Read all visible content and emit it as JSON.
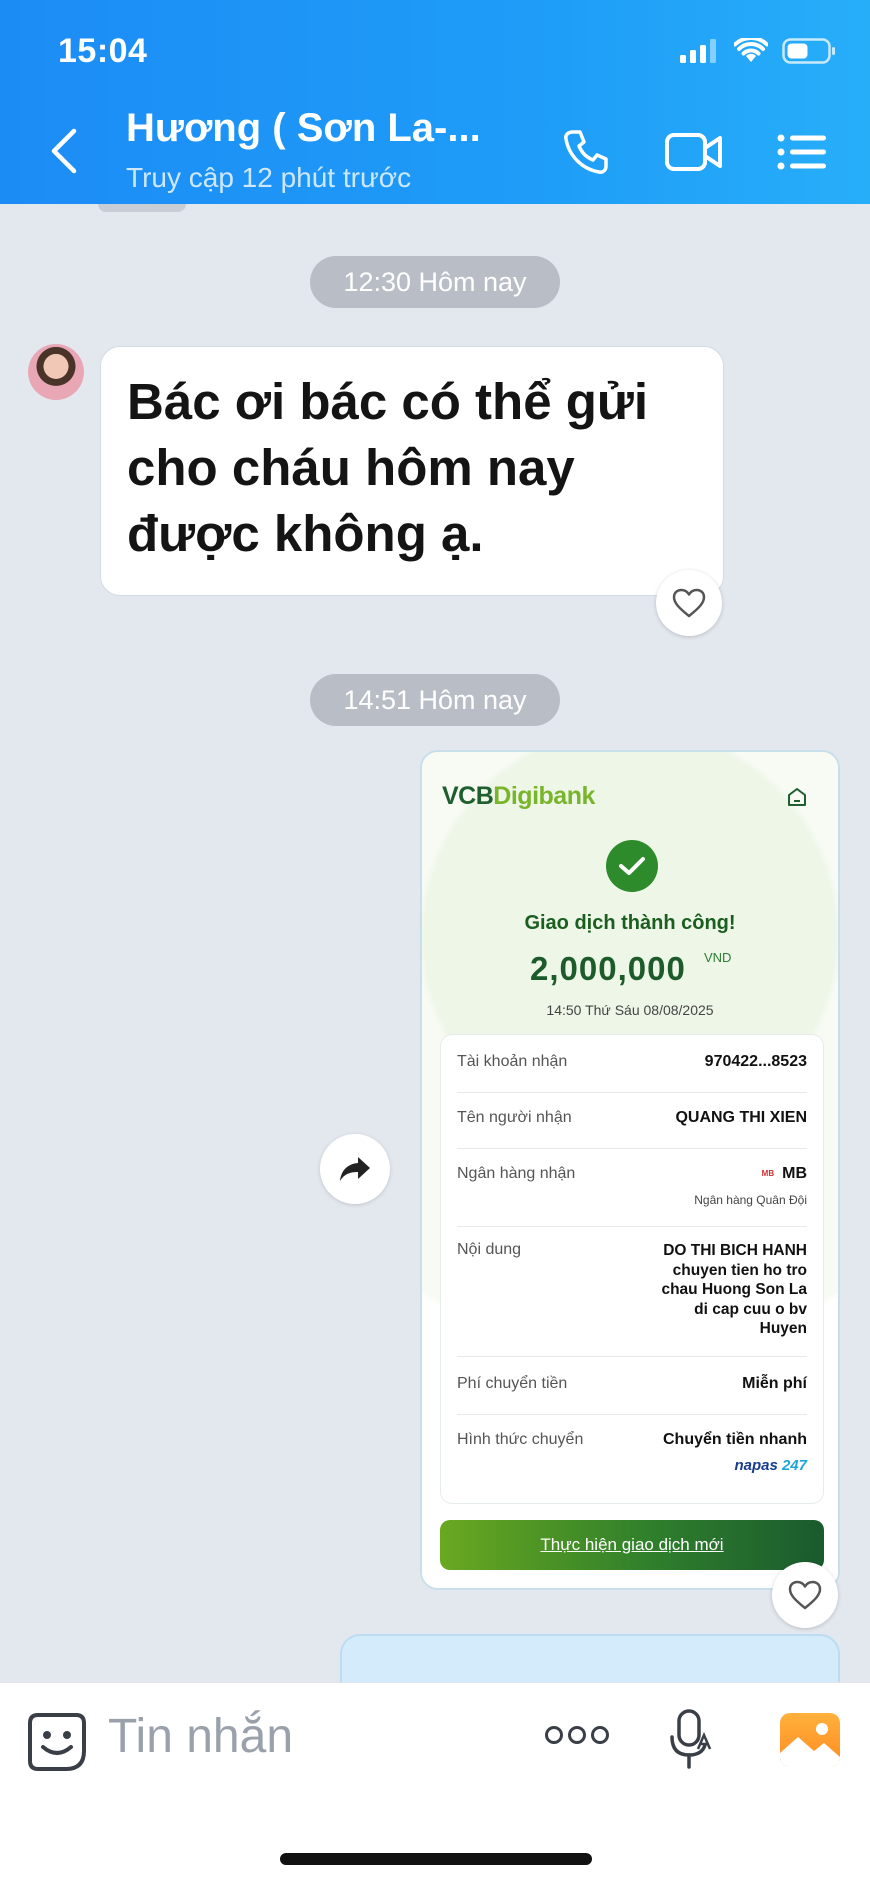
{
  "status_bar": {
    "time": "15:04"
  },
  "header": {
    "contact_name": "Hương ( Sơn La-...",
    "last_seen": "Truy cập 12 phút trước"
  },
  "chat": {
    "timestamps": [
      "12:30 Hôm nay",
      "14:51 Hôm nay"
    ],
    "incoming_message": "Bác ơi bác có thể gửi cho cháu hôm nay được không ạ."
  },
  "receipt": {
    "brand_vcb": "VCB",
    "brand_digibank": "Digibank",
    "status": "Giao dịch thành công!",
    "amount": "2,000,000",
    "currency": "VND",
    "datetime": "14:50 Thứ Sáu 08/08/2025",
    "rows": [
      {
        "label": "Tài khoản nhận",
        "value": "970422...8523"
      },
      {
        "label": "Tên người nhận",
        "value": "QUANG THI XIEN"
      },
      {
        "label": "Ngân hàng nhận",
        "value": "MB",
        "bank_mark": "MB",
        "sub": "Ngân hàng Quân Đội"
      },
      {
        "label": "Nội dung",
        "value_lines": [
          "DO THI BICH HANH",
          "chuyen tien ho tro",
          "chau Huong Son La",
          "di cap cuu o bv",
          "Huyen"
        ]
      },
      {
        "label": "Phí chuyển tiền",
        "value": "Miễn phí"
      },
      {
        "label": "Hình thức chuyển",
        "value": "Chuyển tiền nhanh",
        "network": "napas",
        "network_suffix": "247"
      }
    ],
    "button_label": "Thực hiện giao dịch mới"
  },
  "input_bar": {
    "placeholder": "Tin nhắn"
  },
  "icons": {
    "back": "chevron-left-icon",
    "call": "phone-icon",
    "video": "video-camera-icon",
    "menu": "list-menu-icon",
    "heart": "heart-icon",
    "share": "share-arrow-icon",
    "sticker": "sticker-smile-icon",
    "more": "more-dots-icon",
    "mic": "microphone-icon",
    "gallery": "image-gallery-icon"
  },
  "colors": {
    "header_blue": "#1e9cf8",
    "vcb_green": "#1f5e2e",
    "digibank_green": "#79b52a",
    "success_green": "#2e8b2c"
  }
}
